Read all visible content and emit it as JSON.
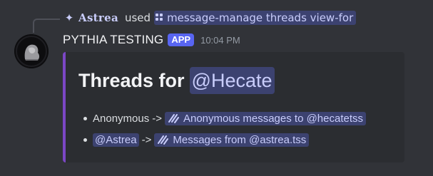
{
  "usage": {
    "spark_icon": "sparkle-icon",
    "user": "Astrea",
    "used_label": "used",
    "command": "message-manage threads view-for",
    "command_icon": "slash-command-icon"
  },
  "message": {
    "author": "PYTHIA TESTING",
    "app_tag": "APP",
    "timestamp": "10:04 PM",
    "avatar_icon": "bot-avatar"
  },
  "embed": {
    "accent_color": "#7b47c5",
    "title_prefix": "Threads for",
    "title_mention": "@Hecate",
    "items": [
      {
        "user": "Anonymous",
        "arrow": "->",
        "thread": "Anonymous messages to @hecatetss",
        "thread_icon": "thread-icon"
      },
      {
        "user": "@Astrea",
        "arrow": "->",
        "thread": "Messages from @astrea.tss",
        "thread_icon": "thread-icon"
      }
    ]
  }
}
